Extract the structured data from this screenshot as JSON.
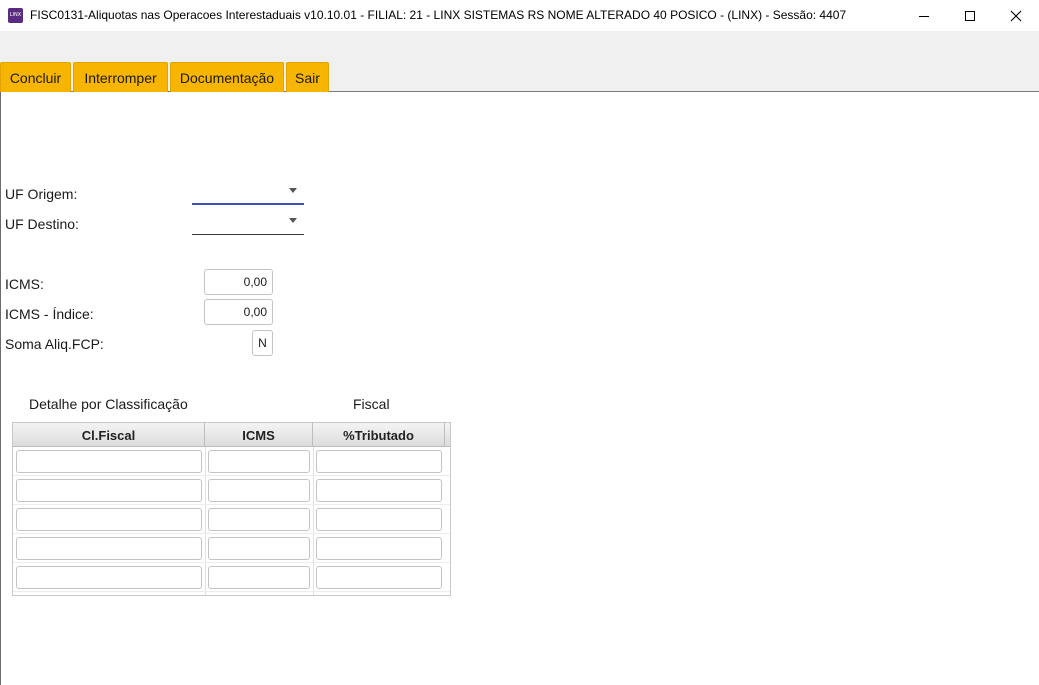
{
  "window": {
    "title": "FISC0131-Aliquotas nas Operacoes Interestaduais v10.10.01   - FILIAL: 21 - LINX SISTEMAS RS NOME ALTERADO 40 POSICO - (LINX) - Sessão: 4407",
    "app_icon_text": "LINX",
    "app_icon": "linx-app-icon",
    "minimize_icon": "minimize-icon",
    "maximize_icon": "maximize-icon",
    "close_icon": "close-icon"
  },
  "toolbar": {
    "concluir_label": "Concluir",
    "interromper_label": "Interromper",
    "documentacao_label": "Documentação",
    "sair_label": "Sair",
    "button_color": "#f7b500"
  },
  "form": {
    "uf_origem_label": "UF Origem:",
    "uf_origem_value": "",
    "uf_destino_label": "UF Destino:",
    "uf_destino_value": "",
    "icms_label": "ICMS:",
    "icms_value": "0,00",
    "icms_indice_label": "ICMS - Índice:",
    "icms_indice_value": "0,00",
    "soma_aliq_fcp_label": "Soma Aliq.FCP:",
    "soma_aliq_fcp_value": "N",
    "focus_color": "#3f51b5"
  },
  "detalhe": {
    "title_left": "Detalhe por Classificação",
    "title_right": "Fiscal",
    "columns": [
      "Cl.Fiscal",
      "ICMS",
      "%Tributado"
    ],
    "rows": [
      [
        "",
        "",
        ""
      ],
      [
        "",
        "",
        ""
      ],
      [
        "",
        "",
        ""
      ],
      [
        "",
        "",
        ""
      ],
      [
        "",
        "",
        ""
      ]
    ]
  }
}
